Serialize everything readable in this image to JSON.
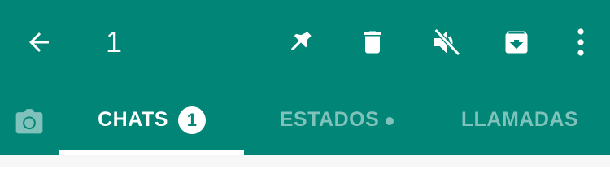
{
  "header": {
    "selected_count": "1",
    "icons": [
      "back-arrow-icon",
      "pin-icon",
      "delete-icon",
      "mute-icon",
      "archive-icon",
      "more-vert-icon"
    ]
  },
  "tabs": {
    "chats_label": "CHATS",
    "chats_badge": "1",
    "estados_label": "ESTADOS",
    "llamadas_label": "LLAMADAS",
    "active": "CHATS"
  },
  "colors": {
    "brand": "#008577",
    "inactive_tab_text": "#7FC2BB",
    "text_on_brand": "#FFFFFF"
  }
}
